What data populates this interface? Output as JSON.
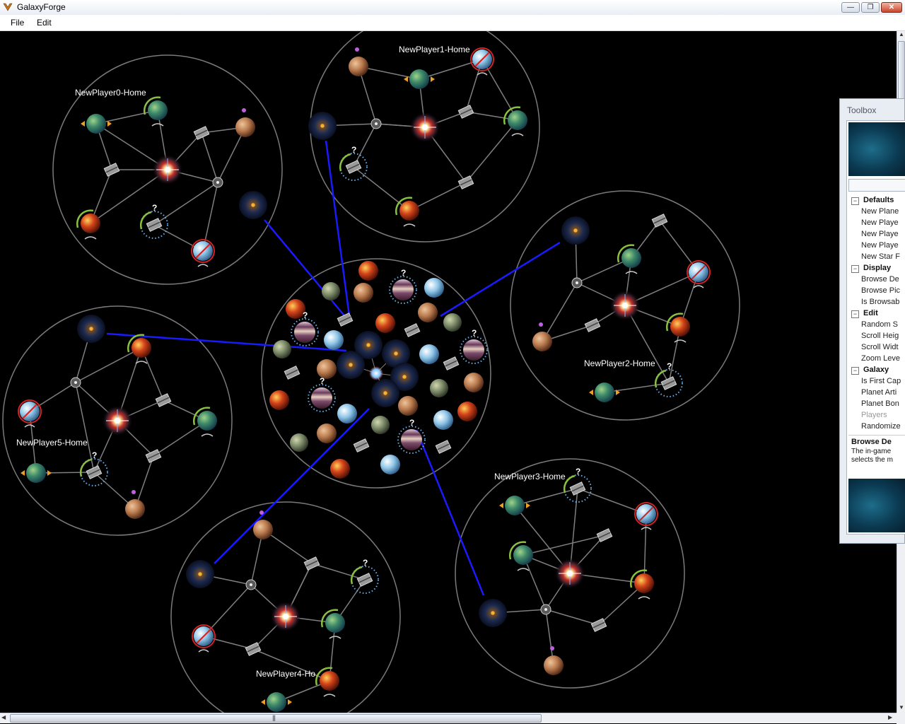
{
  "window": {
    "title": "GalaxyForge"
  },
  "menu": {
    "file": "File",
    "edit": "Edit"
  },
  "systems": {
    "p0": {
      "name": "NewPlayer0-Home"
    },
    "p1": {
      "name": "NewPlayer1-Home"
    },
    "p2": {
      "name": "NewPlayer2-Home"
    },
    "p3": {
      "name": "NewPlayer3-Home"
    },
    "p4": {
      "name": "NewPlayer4-Ho"
    },
    "p5": {
      "name": "NewPlayer5-Home"
    }
  },
  "unknown_marker": "?",
  "toolbox": {
    "title": "Toolbox",
    "categories": [
      {
        "label": "Defaults",
        "items": [
          "New Plane",
          "New Playe",
          "New Playe",
          "New Playe",
          "New Star F"
        ]
      },
      {
        "label": "Display",
        "items": [
          "Browse De",
          "Browse Pic",
          "Is Browsab"
        ]
      },
      {
        "label": "Edit",
        "items": [
          "Random S",
          "Scroll Heig",
          "Scroll Widt",
          "Zoom Leve"
        ]
      },
      {
        "label": "Galaxy",
        "items": [
          "Is First Cap",
          "Planet Arti",
          "Planet Bon",
          "Players",
          "Randomize"
        ]
      }
    ],
    "description": {
      "title": "Browse De",
      "text": "The in-game selects the m"
    }
  },
  "colors": {
    "lane": "#7f7f7f",
    "phase_link": "#1a1aff",
    "orbit": "#7a7a7a"
  }
}
